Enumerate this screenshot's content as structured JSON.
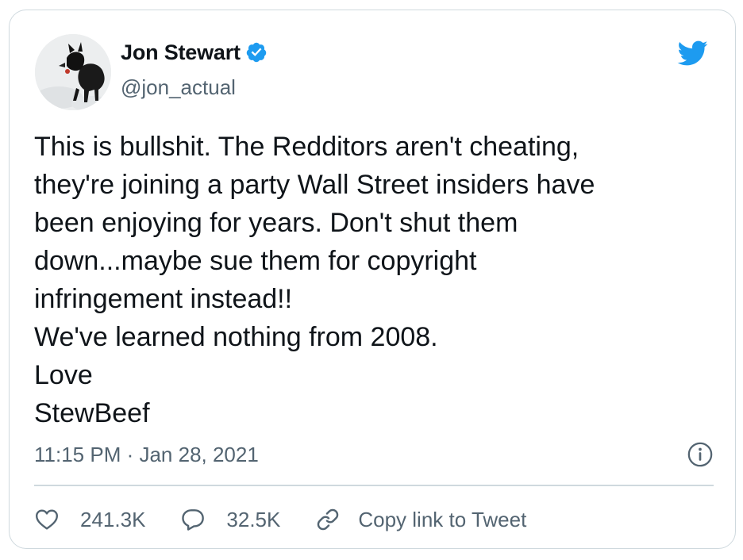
{
  "tweet": {
    "author": {
      "display_name": "Jon Stewart",
      "handle": "@jon_actual",
      "verified": true,
      "avatar_icon": "dog-photo-avatar",
      "verified_icon": "verified-badge-icon"
    },
    "text": "This is bullshit. The Redditors aren't cheating,\nthey're joining a party Wall Street insiders have\nbeen enjoying for years. Don't shut them\ndown...maybe sue them for copyright\ninfringement instead!!\nWe've learned nothing from 2008.\nLove\nStewBeef",
    "timestamp": "11:15 PM · Jan 28, 2021",
    "actions": {
      "likes": "241.3K",
      "replies": "32.5K",
      "copy_link": "Copy link to Tweet"
    }
  },
  "colors": {
    "brand_blue": "#1d9bf0",
    "secondary_text": "#536471",
    "border": "#cfd9de",
    "primary_text": "#0f1419"
  },
  "icons": {
    "brand": "twitter-bird-icon",
    "info": "info-icon",
    "like": "heart-icon",
    "reply": "speech-bubble-icon",
    "copy": "link-icon"
  }
}
